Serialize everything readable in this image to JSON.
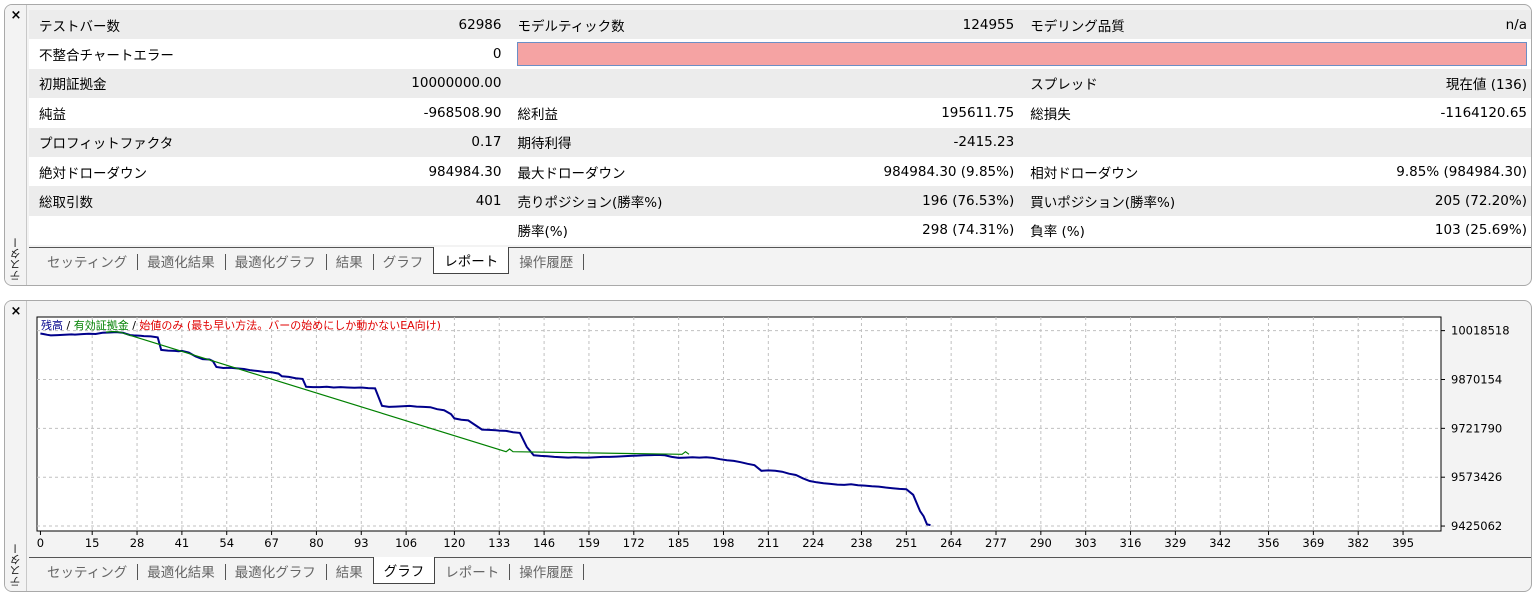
{
  "top_panel": {
    "close": "×",
    "side_label": "テスター",
    "report": {
      "rows": [
        {
          "c": [
            {
              "t": "テストバー数"
            },
            {
              "t": "62986",
              "n": 1
            },
            {
              "t": "モデルティック数"
            },
            {
              "t": "124955",
              "n": 1
            },
            {
              "t": "モデリング品質"
            },
            {
              "t": "n/a",
              "n": 1
            }
          ]
        },
        {
          "c": [
            {
              "t": "不整合チャートエラー"
            },
            {
              "t": "0",
              "n": 1
            },
            {
              "bar": 1
            }
          ]
        },
        {
          "c": [
            {
              "t": "初期証拠金"
            },
            {
              "t": "10000000.00",
              "n": 1
            },
            {
              "t": ""
            },
            {
              "t": "",
              "n": 1
            },
            {
              "t": "スプレッド"
            },
            {
              "t": "現在値 (136)",
              "n": 1
            }
          ]
        },
        {
          "c": [
            {
              "t": "純益"
            },
            {
              "t": "-968508.90",
              "n": 1
            },
            {
              "t": "総利益"
            },
            {
              "t": "195611.75",
              "n": 1
            },
            {
              "t": "総損失"
            },
            {
              "t": "-1164120.65",
              "n": 1
            }
          ]
        },
        {
          "c": [
            {
              "t": "プロフィットファクタ"
            },
            {
              "t": "0.17",
              "n": 1
            },
            {
              "t": "期待利得"
            },
            {
              "t": "-2415.23",
              "n": 1
            },
            {
              "t": ""
            },
            {
              "t": "",
              "n": 1
            }
          ]
        },
        {
          "c": [
            {
              "t": "絶対ドローダウン"
            },
            {
              "t": "984984.30",
              "n": 1
            },
            {
              "t": "最大ドローダウン"
            },
            {
              "t": "984984.30 (9.85%)",
              "n": 1
            },
            {
              "t": "相対ドローダウン"
            },
            {
              "t": "9.85% (984984.30)",
              "n": 1
            }
          ]
        },
        {
          "c": [
            {
              "t": "総取引数"
            },
            {
              "t": "401",
              "n": 1
            },
            {
              "t": "売りポジション(勝率%)"
            },
            {
              "t": "196 (76.53%)",
              "n": 1
            },
            {
              "t": "買いポジション(勝率%)"
            },
            {
              "t": "205 (72.20%)",
              "n": 1
            }
          ]
        },
        {
          "c": [
            {
              "t": ""
            },
            {
              "t": "",
              "n": 1
            },
            {
              "t": "勝率(%)"
            },
            {
              "t": "298 (74.31%)",
              "n": 1
            },
            {
              "t": "負率 (%)"
            },
            {
              "t": "103 (25.69%)",
              "n": 1
            }
          ]
        }
      ],
      "error_bar_color": "#f5a3a3"
    },
    "tabs": [
      "セッティング",
      "最適化結果",
      "最適化グラフ",
      "結果",
      "グラフ",
      "レポート",
      "操作履歴"
    ],
    "active_tab": 5
  },
  "bottom_panel": {
    "close": "×",
    "side_label": "テスター",
    "tabs": [
      "セッティング",
      "最適化結果",
      "最適化グラフ",
      "結果",
      "グラフ",
      "レポート",
      "操作履歴"
    ],
    "active_tab": 4
  },
  "chart_data": {
    "type": "line",
    "legend": [
      {
        "text": "残高",
        "color": "#00008b"
      },
      {
        "text": " / ",
        "color": "#000000"
      },
      {
        "text": "有効証拠金",
        "color": "#008000"
      },
      {
        "text": " / ",
        "color": "#000000"
      },
      {
        "text": "始値のみ (最も早い方法。バーの始めにしか動かないEA向け)",
        "color": "#e00000"
      }
    ],
    "x_ticks": [
      0,
      15,
      28,
      41,
      54,
      67,
      80,
      93,
      106,
      120,
      133,
      146,
      159,
      172,
      185,
      198,
      211,
      224,
      238,
      251,
      264,
      277,
      290,
      303,
      316,
      329,
      342,
      356,
      369,
      382,
      395
    ],
    "x_tick_labels": [
      "0",
      "15",
      "28",
      "41",
      "54",
      "67",
      "80",
      "93",
      "106",
      "120",
      "133",
      "146",
      "159",
      "172",
      "185",
      "198",
      "211",
      "224",
      "238",
      "251",
      "264",
      "277",
      "290",
      "303",
      "316",
      "329",
      "342",
      "356",
      "369",
      "382",
      "395"
    ],
    "y_ticks": [
      10018518,
      9870154,
      9721790,
      9573426,
      9425062
    ],
    "y_tick_labels": [
      "10018518",
      "9870154",
      "9721790",
      "9573426",
      "9425062"
    ],
    "xlim": [
      -1,
      406
    ],
    "ylim": [
      9410000,
      10060000
    ],
    "grid": true,
    "series": [
      {
        "name": "残高",
        "color": "#00008b",
        "x": [
          0,
          1,
          2,
          3,
          5,
          7,
          9,
          10,
          12,
          14,
          16,
          18,
          20,
          22,
          24,
          26,
          27,
          29,
          30,
          32,
          34,
          35,
          37,
          39,
          40,
          41,
          43,
          45,
          47,
          49,
          50,
          51,
          53,
          55,
          57,
          59,
          61,
          63,
          65,
          67,
          69,
          70,
          72,
          74,
          76,
          77,
          79,
          81,
          83,
          85,
          87,
          89,
          91,
          93,
          95,
          97,
          99,
          101,
          103,
          105,
          107,
          109,
          111,
          113,
          115,
          117,
          119,
          120,
          122,
          124,
          126,
          128,
          130,
          132,
          133,
          135,
          137,
          139,
          141,
          143,
          145,
          147,
          149,
          151,
          153,
          155,
          157,
          159,
          161,
          163,
          165,
          167,
          169,
          171,
          173,
          175,
          177,
          179,
          181,
          183,
          185,
          187,
          189,
          191,
          193,
          195,
          197,
          199,
          201,
          203,
          205,
          207,
          209,
          211,
          213,
          215,
          217,
          219,
          221,
          223,
          225,
          227,
          229,
          231,
          233,
          235,
          237,
          239,
          241,
          243,
          245,
          247,
          249,
          251,
          253,
          255,
          256,
          257,
          258
        ],
        "y": [
          10010000,
          10008000,
          10006000,
          10004000,
          10005000,
          10006000,
          10007000,
          10006500,
          10008000,
          10009000,
          10008500,
          10012000,
          10013000,
          10014000,
          10012000,
          10005000,
          10004000,
          10003000,
          10002000,
          10001000,
          9998000,
          9960000,
          9958000,
          9957000,
          9956000,
          9957000,
          9952000,
          9940000,
          9932000,
          9931000,
          9926000,
          9908000,
          9905000,
          9906000,
          9904000,
          9902000,
          9898000,
          9896000,
          9893000,
          9892000,
          9888000,
          9880000,
          9878000,
          9874000,
          9872000,
          9848000,
          9847000,
          9847000,
          9848000,
          9846000,
          9847000,
          9846000,
          9845000,
          9846000,
          9844000,
          9843000,
          9790000,
          9787000,
          9788000,
          9789000,
          9790000,
          9788000,
          9787000,
          9786000,
          9780000,
          9777000,
          9765000,
          9752000,
          9748000,
          9746000,
          9732000,
          9718000,
          9717000,
          9716000,
          9715000,
          9714000,
          9710000,
          9708000,
          9665000,
          9640000,
          9638000,
          9637000,
          9635000,
          9634000,
          9633000,
          9634000,
          9633000,
          9633000,
          9634000,
          9635000,
          9635000,
          9636000,
          9637000,
          9638000,
          9639000,
          9640000,
          9640500,
          9641000,
          9640000,
          9635000,
          9632000,
          9633000,
          9634000,
          9633000,
          9634000,
          9632000,
          9628000,
          9625000,
          9623000,
          9619000,
          9614000,
          9610000,
          9593000,
          9594000,
          9593000,
          9590000,
          9584000,
          9580000,
          9570000,
          9562000,
          9558000,
          9555000,
          9553000,
          9551000,
          9550000,
          9552000,
          9549000,
          9548000,
          9546000,
          9545000,
          9542000,
          9540000,
          9538000,
          9537000,
          9520000,
          9470000,
          9455000,
          9430000,
          9428000
        ]
      },
      {
        "name": "有効証拠金",
        "color": "#008000",
        "x": [
          19,
          21,
          23,
          135,
          136,
          137,
          186,
          187,
          188
        ],
        "y": [
          10014000,
          10016000,
          10014000,
          9651000,
          9659000,
          9651000,
          9643000,
          9651000,
          9643000
        ]
      }
    ]
  }
}
